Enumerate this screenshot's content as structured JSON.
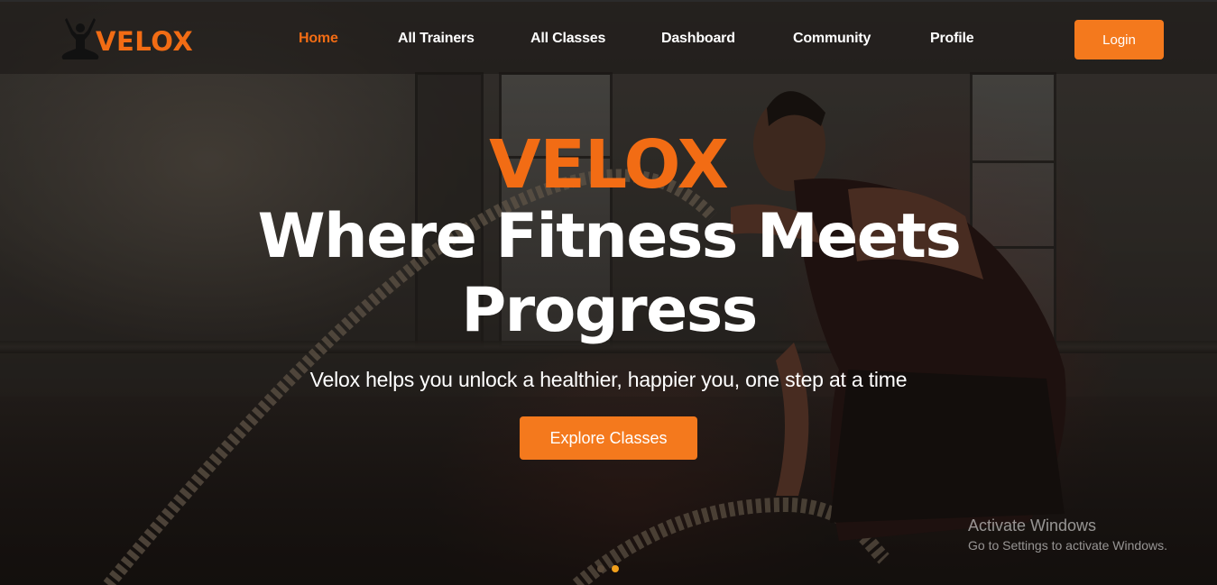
{
  "brand": {
    "name": "VELOX",
    "accent_color": "#f26c14",
    "logo_icon": "meditating-figure-icon"
  },
  "nav": {
    "items": [
      {
        "label": "Home",
        "active": true
      },
      {
        "label": "All Trainers",
        "active": false
      },
      {
        "label": "All Classes",
        "active": false
      },
      {
        "label": "Dashboard",
        "active": false
      },
      {
        "label": "Community",
        "active": false
      },
      {
        "label": "Profile",
        "active": false
      }
    ],
    "login_label": "Login"
  },
  "hero": {
    "brand_title": "VELOX",
    "headline": "Where Fitness Meets Progress",
    "subline": "Velox helps you unlock a healthier, happier you, one step at a time",
    "cta_label": "Explore Classes",
    "slides_total": 2,
    "active_slide": 2
  },
  "watermark": {
    "title": "Activate Windows",
    "subtitle": "Go to Settings to activate Windows."
  },
  "colors": {
    "button": "#f4791d",
    "dot_active": "#f2a01c"
  }
}
